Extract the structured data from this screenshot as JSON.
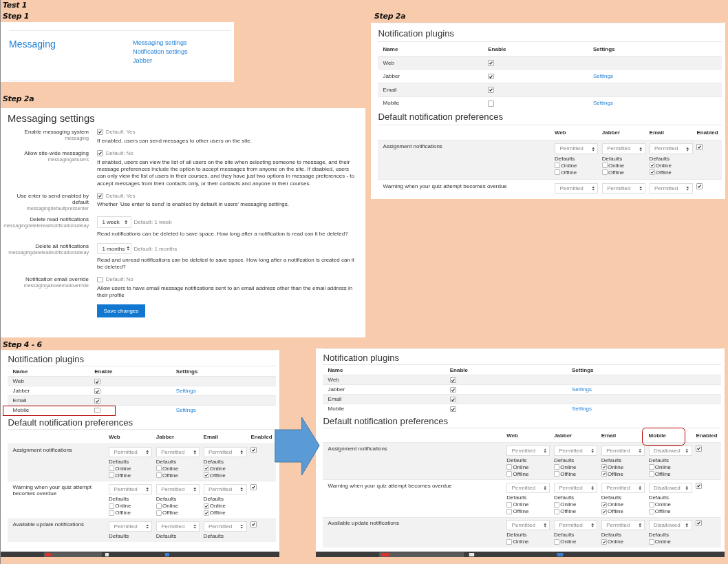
{
  "title": "Test 1",
  "panels": [
    {
      "kind": "menu",
      "step_label": "Step 1",
      "heading": "Messaging",
      "links": [
        "Messaging settings",
        "Notification settings",
        "Jabber"
      ]
    },
    {
      "kind": "settings_form",
      "step_label": "Step 2a",
      "heading": "Messaging settings",
      "settings": [
        {
          "kind": "checkbox",
          "label": "Enable messaging system",
          "code": "messaging",
          "checked": true,
          "default_text": "Default: Yes",
          "description": "If enabled, users can send messages to other users on the site."
        },
        {
          "kind": "checkbox",
          "label": "Allow site-wide messaging",
          "code": "messagingallusers",
          "checked": true,
          "default_text": "Default: No",
          "description": "If enabled, users can view the list of all users on the site when selecting someone to message, and their message preferences include the option to accept messages from anyone on the site. If disabled, users can only view the list of users in their courses, and they have just two options in message preferences - to accept messages from their contacts only, or their contacts and anyone in their courses."
        },
        {
          "kind": "checkbox",
          "label": "Use enter to send enabled by default",
          "code": "messagingdefaultpressenter",
          "checked": true,
          "default_text": "Default: Yes",
          "description": "Whether 'Use enter to send' is enabled by default in users' messaging settings."
        },
        {
          "kind": "select",
          "label": "Delete read notifications",
          "code": "messagingdeletereadnotificationsdelay",
          "value": "1 week",
          "default_text": "Default: 1 week",
          "description": "Read notifications can be deleted to save space. How long after a notification is read can it be deleted?"
        },
        {
          "kind": "select",
          "label": "Delete all notifications",
          "code": "messagingdeleteallnotificationsdelay",
          "value": "1 months",
          "default_text": "Default: 1 months",
          "description": "Read and unread notifications can be deleted to save space. How long after a notification is created can it be deleted?"
        },
        {
          "kind": "checkbox",
          "label": "Notification email override",
          "code": "messagingallowemailoverride",
          "checked": false,
          "default_text": "Default: No",
          "description": "Allow users to have email message notifications sent to an email address other than the email address in their profile"
        }
      ],
      "button": "Save changes"
    },
    {
      "kind": "notifications",
      "step_label": "Step 2a",
      "plugins_title": "Notification plugins",
      "plugin_columns": [
        "Name",
        "Enable",
        "Settings"
      ],
      "plugins": [
        {
          "name": "Web",
          "enabled": true,
          "highlighted": false
        },
        {
          "name": "Jabber",
          "enabled": true,
          "settings": "Settings",
          "highlighted": false
        },
        {
          "name": "Email",
          "enabled": true,
          "highlighted": false
        },
        {
          "name": "Mobile",
          "enabled": false,
          "settings": "Settings",
          "highlighted": false
        }
      ],
      "prefs_title": "Default notification preferences",
      "pref_columns": [
        {
          "label": "Web",
          "highlighted": false
        },
        {
          "label": "Jabber",
          "highlighted": false
        },
        {
          "label": "Email",
          "highlighted": false
        }
      ],
      "enabled_column": "Enabled",
      "preferences": [
        {
          "name": "Assignment notifications",
          "enabled": true,
          "outputs": [
            {
              "value": "Permitted",
              "defaults_label": "Defaults",
              "options": [
                {
                  "label": "Online",
                  "checked": false
                },
                {
                  "label": "Offline",
                  "checked": false
                }
              ]
            },
            {
              "value": "Permitted",
              "defaults_label": "Defaults",
              "options": [
                {
                  "label": "Online",
                  "checked": false
                },
                {
                  "label": "Offline",
                  "checked": false
                }
              ]
            },
            {
              "value": "Permitted",
              "defaults_label": "Defaults",
              "options": [
                {
                  "label": "Online",
                  "checked": true
                },
                {
                  "label": "Offline",
                  "checked": true
                }
              ]
            }
          ]
        },
        {
          "name": "Warning when your quiz attempt becomes overdue",
          "enabled": true,
          "outputs": [
            {
              "value": "Permitted"
            },
            {
              "value": "Permitted"
            },
            {
              "value": "Permitted"
            }
          ]
        }
      ],
      "taskbar": false
    },
    {
      "kind": "notifications",
      "step_label": "Step 4 - 6",
      "plugins_title": "Notification plugins",
      "plugin_columns": [
        "Name",
        "Enable",
        "Settings"
      ],
      "plugins": [
        {
          "name": "Web",
          "enabled": true,
          "highlighted": false
        },
        {
          "name": "Jabber",
          "enabled": true,
          "settings": "Settings",
          "highlighted": false
        },
        {
          "name": "Email",
          "enabled": true,
          "highlighted": false
        },
        {
          "name": "Mobile",
          "enabled": false,
          "settings": "Settings",
          "highlighted": true
        }
      ],
      "prefs_title": "Default notification preferences",
      "pref_columns": [
        {
          "label": "Web",
          "highlighted": false
        },
        {
          "label": "Jabber",
          "highlighted": false
        },
        {
          "label": "Email",
          "highlighted": false
        }
      ],
      "enabled_column": "Enabled",
      "preferences": [
        {
          "name": "Assignment notifications",
          "enabled": true,
          "outputs": [
            {
              "value": "Permitted",
              "defaults_label": "Defaults",
              "options": [
                {
                  "label": "Online",
                  "checked": false
                },
                {
                  "label": "Offline",
                  "checked": false
                }
              ]
            },
            {
              "value": "Permitted",
              "defaults_label": "Defaults",
              "options": [
                {
                  "label": "Online",
                  "checked": false
                },
                {
                  "label": "Offline",
                  "checked": false
                }
              ]
            },
            {
              "value": "Permitted",
              "defaults_label": "Defaults",
              "options": [
                {
                  "label": "Online",
                  "checked": true
                },
                {
                  "label": "Offline",
                  "checked": true
                }
              ]
            }
          ]
        },
        {
          "name": "Warning when your quiz attempt becomes overdue",
          "enabled": true,
          "outputs": [
            {
              "value": "Permitted",
              "defaults_label": "Defaults",
              "options": [
                {
                  "label": "Online",
                  "checked": false
                },
                {
                  "label": "Offline",
                  "checked": false
                }
              ]
            },
            {
              "value": "Permitted",
              "defaults_label": "Defaults",
              "options": [
                {
                  "label": "Online",
                  "checked": false
                },
                {
                  "label": "Offline",
                  "checked": false
                }
              ]
            },
            {
              "value": "Permitted",
              "defaults_label": "Defaults",
              "options": [
                {
                  "label": "Online",
                  "checked": true
                },
                {
                  "label": "Offline",
                  "checked": true
                }
              ]
            }
          ]
        },
        {
          "name": "Available update notifications",
          "enabled": true,
          "outputs": [
            {
              "value": "Permitted",
              "defaults_label": "Defaults"
            },
            {
              "value": "Permitted",
              "defaults_label": "Defaults"
            },
            {
              "value": "Permitted",
              "defaults_label": "Defaults"
            }
          ]
        }
      ],
      "taskbar": true
    },
    {
      "kind": "notifications",
      "plugins_title": "Notification plugins",
      "plugin_columns": [
        "Name",
        "Enable",
        "Settings"
      ],
      "plugins": [
        {
          "name": "Web",
          "enabled": true,
          "highlighted": false
        },
        {
          "name": "Jabber",
          "enabled": true,
          "settings": "Settings",
          "highlighted": false
        },
        {
          "name": "Email",
          "enabled": true,
          "highlighted": false
        },
        {
          "name": "Mobile",
          "enabled": true,
          "settings": "Settings",
          "highlighted": false
        }
      ],
      "prefs_title": "Default notification preferences",
      "pref_columns": [
        {
          "label": "Web",
          "highlighted": false
        },
        {
          "label": "Jabber",
          "highlighted": false
        },
        {
          "label": "Email",
          "highlighted": false
        },
        {
          "label": "Mobile",
          "highlighted": true
        }
      ],
      "enabled_column": "Enabled",
      "preferences": [
        {
          "name": "Assignment notifications",
          "enabled": true,
          "outputs": [
            {
              "value": "Permitted",
              "defaults_label": "Defaults",
              "options": [
                {
                  "label": "Online",
                  "checked": false
                },
                {
                  "label": "Offline",
                  "checked": false
                }
              ]
            },
            {
              "value": "Permitted",
              "defaults_label": "Defaults",
              "options": [
                {
                  "label": "Online",
                  "checked": false
                },
                {
                  "label": "Offline",
                  "checked": false
                }
              ]
            },
            {
              "value": "Permitted",
              "defaults_label": "Defaults",
              "options": [
                {
                  "label": "Online",
                  "checked": true
                },
                {
                  "label": "Offline",
                  "checked": true
                }
              ]
            },
            {
              "value": "Disallowed",
              "defaults_label": "Defaults",
              "options": [
                {
                  "label": "Online",
                  "checked": false
                },
                {
                  "label": "Offline",
                  "checked": false
                }
              ]
            }
          ]
        },
        {
          "name": "Warning when your quiz attempt becomes overdue",
          "enabled": true,
          "outputs": [
            {
              "value": "Permitted",
              "defaults_label": "Defaults",
              "options": [
                {
                  "label": "Online",
                  "checked": false
                },
                {
                  "label": "Offline",
                  "checked": false
                }
              ]
            },
            {
              "value": "Permitted",
              "defaults_label": "Defaults",
              "options": [
                {
                  "label": "Online",
                  "checked": false
                },
                {
                  "label": "Offline",
                  "checked": false
                }
              ]
            },
            {
              "value": "Permitted",
              "defaults_label": "Defaults",
              "options": [
                {
                  "label": "Online",
                  "checked": true
                },
                {
                  "label": "Offline",
                  "checked": true
                }
              ]
            },
            {
              "value": "Disallowed",
              "defaults_label": "Defaults",
              "options": [
                {
                  "label": "Online",
                  "checked": false
                },
                {
                  "label": "Offline",
                  "checked": false
                }
              ]
            }
          ]
        },
        {
          "name": "Available update notifications",
          "enabled": true,
          "outputs": [
            {
              "value": "Permitted",
              "defaults_label": "Defaults",
              "options": [
                {
                  "label": "Online",
                  "checked": false
                }
              ]
            },
            {
              "value": "Permitted",
              "defaults_label": "Defaults",
              "options": [
                {
                  "label": "Online",
                  "checked": false
                }
              ]
            },
            {
              "value": "Permitted",
              "defaults_label": "Defaults",
              "options": [
                {
                  "label": "Online",
                  "checked": true
                }
              ]
            },
            {
              "value": "Disallowed",
              "defaults_label": "Defaults",
              "options": [
                {
                  "label": "Online",
                  "checked": false
                }
              ]
            }
          ]
        }
      ],
      "taskbar": true
    }
  ]
}
